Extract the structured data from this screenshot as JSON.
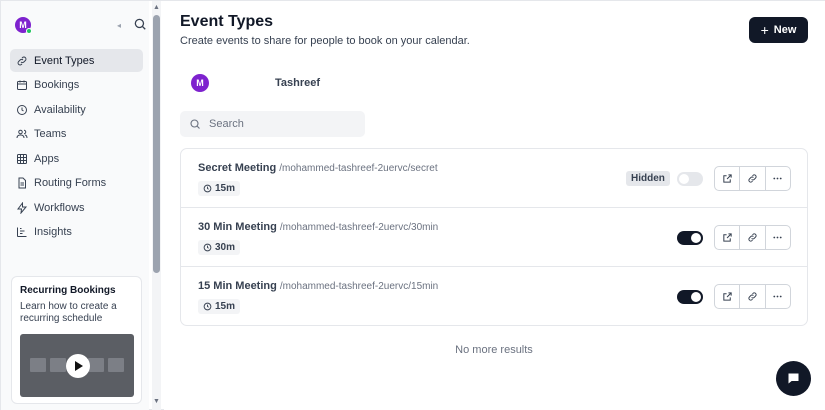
{
  "user": {
    "initial": "M",
    "name": "Tashreef"
  },
  "nav": {
    "items": [
      {
        "label": "Event Types",
        "icon": "link-icon",
        "active": true
      },
      {
        "label": "Bookings",
        "icon": "calendar-icon"
      },
      {
        "label": "Availability",
        "icon": "clock-icon"
      },
      {
        "label": "Teams",
        "icon": "users-icon"
      },
      {
        "label": "Apps",
        "icon": "grid-icon"
      },
      {
        "label": "Routing Forms",
        "icon": "file-text-icon"
      },
      {
        "label": "Workflows",
        "icon": "zap-icon"
      },
      {
        "label": "Insights",
        "icon": "bar-chart-icon"
      }
    ]
  },
  "promo": {
    "title": "Recurring Bookings",
    "description": "Learn how to create a recurring schedule"
  },
  "header": {
    "title": "Event Types",
    "subtitle": "Create events to share for people to book on your calendar.",
    "new_label": "New"
  },
  "search": {
    "placeholder": "Search"
  },
  "events": [
    {
      "title": "Secret Meeting",
      "slug": "/mohammed-tashreef-2uervc/secret",
      "duration": "15m",
      "hidden": true,
      "hidden_label": "Hidden",
      "enabled": false
    },
    {
      "title": "30 Min Meeting",
      "slug": "/mohammed-tashreef-2uervc/30min",
      "duration": "30m",
      "hidden": false,
      "enabled": true
    },
    {
      "title": "15 Min Meeting",
      "slug": "/mohammed-tashreef-2uervc/15min",
      "duration": "15m",
      "hidden": false,
      "enabled": true
    }
  ],
  "footer": {
    "no_more": "No more results"
  },
  "colors": {
    "accent": "#111827",
    "avatar": "#7e22ce",
    "online": "#22c55e"
  }
}
